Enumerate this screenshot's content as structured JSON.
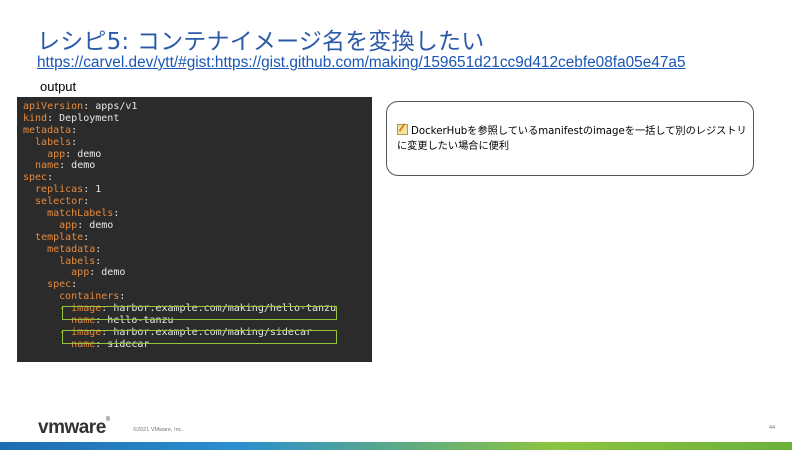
{
  "slide": {
    "title": "レシピ5: コンテナイメージ名を変換したい",
    "link": "https://carvel.dev/ytt/#gist:https://gist.github.com/making/159651d21cc9d412cebfe08fa05e47a5",
    "output_label": "output",
    "note": "DockerHubを参照しているmanifestのimageを一括して別のレジストリに変更したい場合に便利",
    "note_icon": "memo-icon",
    "footer": {
      "logo": "vmware",
      "logo_mark": "®",
      "copyright": "©2021 VMware, Inc.",
      "page_number": "44"
    }
  },
  "code": {
    "lines": [
      {
        "key": "apiVersion",
        "value": " apps/v1"
      },
      {
        "key": "kind",
        "value": " Deployment"
      },
      {
        "key": "metadata",
        "value": ""
      },
      {
        "key": "  labels",
        "value": ""
      },
      {
        "key": "    app",
        "value": " demo"
      },
      {
        "key": "  name",
        "value": " demo"
      },
      {
        "key": "spec",
        "value": ""
      },
      {
        "key": "  replicas",
        "value": " 1"
      },
      {
        "key": "  selector",
        "value": ""
      },
      {
        "key": "    matchLabels",
        "value": ""
      },
      {
        "key": "      app",
        "value": " demo"
      },
      {
        "key": "  template",
        "value": ""
      },
      {
        "key": "    metadata",
        "value": ""
      },
      {
        "key": "      labels",
        "value": ""
      },
      {
        "key": "        app",
        "value": " demo"
      },
      {
        "key": "    spec",
        "value": ""
      },
      {
        "key": "      containers",
        "value": ""
      },
      {
        "key": "      - image",
        "value": " harbor.example.com/making/hello-tanzu"
      },
      {
        "key": "        name",
        "value": " hello-tanzu"
      },
      {
        "key": "      - image",
        "value": " harbor.example.com/making/sidecar"
      },
      {
        "key": "        name",
        "value": " sidecar"
      }
    ]
  },
  "colors": {
    "title": "#2b5aa8",
    "link": "#1a56b7",
    "code_bg": "#2b2b2b",
    "code_key": "#e88a3c",
    "highlight": "#9bc23c"
  }
}
